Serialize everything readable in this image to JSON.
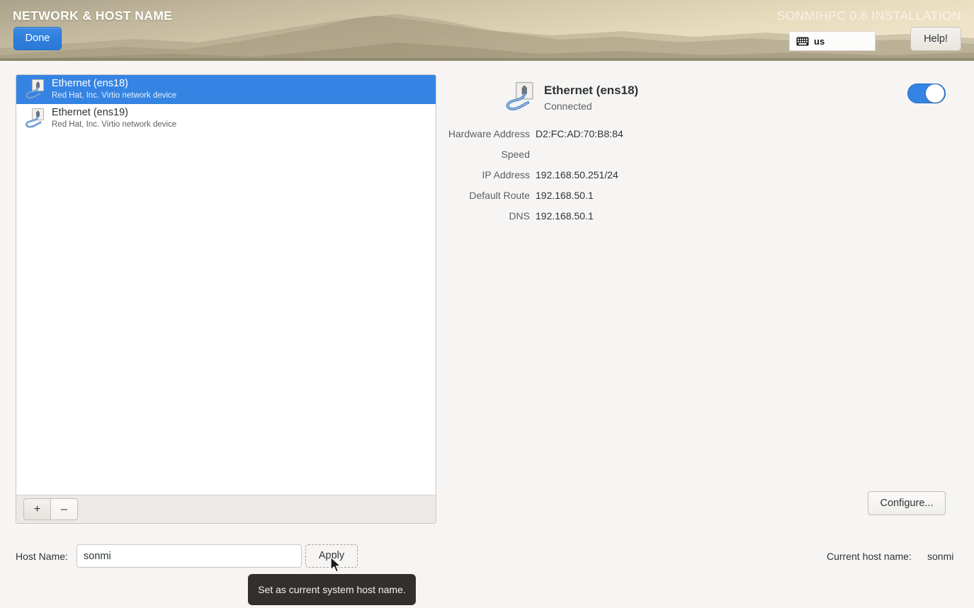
{
  "header": {
    "title": "NETWORK & HOST NAME",
    "install_title": "SONMIHPC 0.6 INSTALLATION",
    "done_label": "Done",
    "help_label": "Help!",
    "keyboard_layout": "us",
    "keyboard_icon": "keyboard-icon",
    "background_start": "#b0a88f",
    "background_end": "#ece1c5",
    "accent_blue": "#3584e4"
  },
  "device_list": {
    "items": [
      {
        "name": "Ethernet (ens18)",
        "description": "Red Hat, Inc. Virtio network device",
        "icon": "ethernet-icon",
        "selected": true
      },
      {
        "name": "Ethernet (ens19)",
        "description": "Red Hat, Inc. Virtio network device",
        "icon": "ethernet-icon",
        "selected": false
      }
    ],
    "toolbar": {
      "add_label": "+",
      "remove_label": "–"
    }
  },
  "details": {
    "device_name": "Ethernet (ens18)",
    "status": "Connected",
    "icon": "ethernet-icon",
    "toggle_on": true,
    "fields": [
      {
        "label": "Hardware Address",
        "value": "D2:FC:AD:70:B8:84"
      },
      {
        "label": "Speed",
        "value": ""
      },
      {
        "label": "IP Address",
        "value": "192.168.50.251/24"
      },
      {
        "label": "Default Route",
        "value": "192.168.50.1"
      },
      {
        "label": "DNS",
        "value": "192.168.50.1"
      }
    ],
    "configure_label": "Configure..."
  },
  "bottom": {
    "hostname_label": "Host Name:",
    "hostname_value": "sonmi",
    "hostname_placeholder": "",
    "apply_label": "Apply",
    "current_hostname_label": "Current host name:",
    "current_hostname_value": "sonmi",
    "tooltip_text": "Set as current system host name."
  }
}
